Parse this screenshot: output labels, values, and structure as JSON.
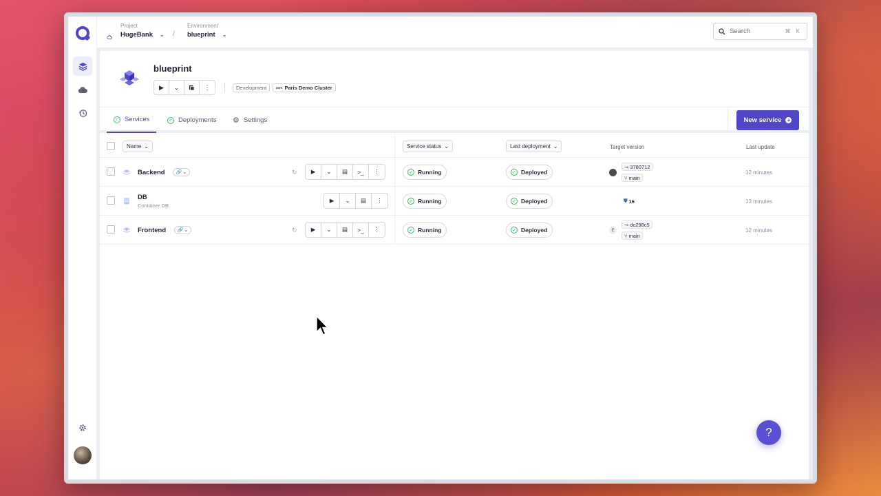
{
  "topbar": {
    "project_label": "Project",
    "project_value": "HugeBank",
    "environment_label": "Environment",
    "environment_value": "blueprint",
    "separator": "/",
    "search_placeholder": "Search",
    "search_shortcut": "⌘ K"
  },
  "env": {
    "title": "blueprint",
    "tags": [
      "Development",
      "Paris Demo Cluster"
    ]
  },
  "tabs": [
    {
      "label": "Services",
      "active": true
    },
    {
      "label": "Deployments",
      "active": false
    },
    {
      "label": "Settings",
      "active": false
    }
  ],
  "new_service_label": "New service",
  "table": {
    "headers": {
      "name": "Name",
      "service_status": "Service status",
      "last_deployment": "Last deployment",
      "target_version": "Target version",
      "last_update": "Last update"
    },
    "rows": [
      {
        "name": "Backend",
        "sub": "",
        "status": "Running",
        "deployment": "Deployed",
        "commit": "3780712",
        "branch": "main",
        "updated": "12 minutes"
      },
      {
        "name": "DB",
        "sub": "Container DB",
        "status": "Running",
        "deployment": "Deployed",
        "version": "16",
        "updated": "13 minutes"
      },
      {
        "name": "Frontend",
        "sub": "",
        "status": "Running",
        "deployment": "Deployed",
        "author_initial": "E",
        "commit": "dc298c5",
        "branch": "main",
        "updated": "12 minutes"
      }
    ]
  },
  "help_label": "?",
  "colors": {
    "accent": "#4f46c8",
    "ok": "#3bb26c"
  }
}
